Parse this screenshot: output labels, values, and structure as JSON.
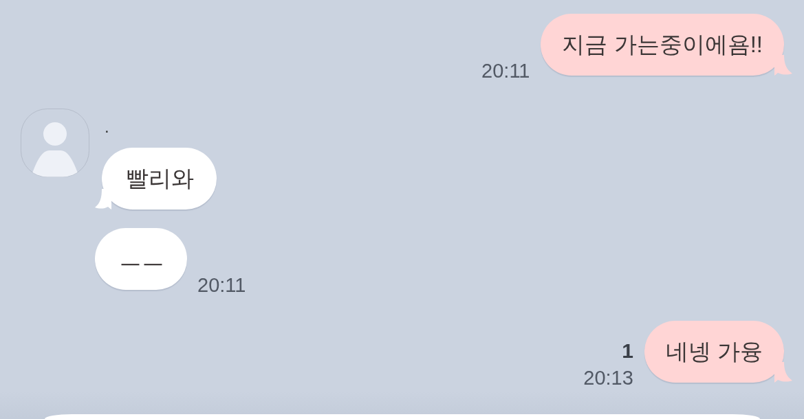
{
  "messages": [
    {
      "kind": "sent",
      "bubbles": [
        "지금 가는중이에욤!!"
      ],
      "time": "20:11"
    },
    {
      "kind": "received",
      "sender": ".",
      "bubbles": [
        "빨리와",
        "ㅡㅡ"
      ],
      "time": "20:11"
    },
    {
      "kind": "sent",
      "bubbles": [
        "네넹 가융"
      ],
      "unread": "1",
      "time": "20:13"
    }
  ]
}
